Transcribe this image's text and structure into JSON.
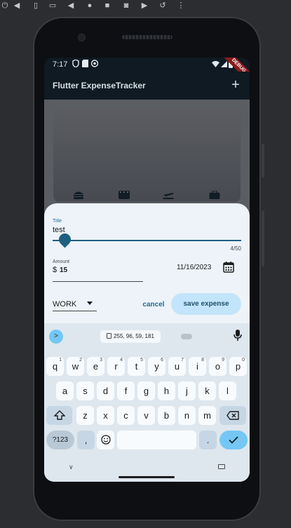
{
  "emulator_toolbar": {
    "icons": [
      "power-icon",
      "volume-up-icon",
      "volume-down-icon",
      "rotate-left-icon",
      "rotate-right-icon",
      "back-icon",
      "home-icon",
      "overview-icon",
      "camera-icon",
      "video-icon",
      "replay-icon",
      "more-icon"
    ]
  },
  "status_bar": {
    "time": "7:17",
    "debug_label": "DEBUG"
  },
  "app_bar": {
    "title": "Flutter ExpenseTracker",
    "add_icon": "+"
  },
  "chart": {
    "categories": [
      "food-icon",
      "movie-icon",
      "flight-icon",
      "work-icon"
    ]
  },
  "form": {
    "title_label": "Title",
    "title_value": "test",
    "counter": "4/50",
    "amount_label": "Amount",
    "amount_prefix": "$",
    "amount_value": "15",
    "date": "11/16/2023",
    "category": "WORK",
    "cancel_label": "cancel",
    "save_label": "save expense"
  },
  "keyboard": {
    "clipboard_text": "255, 96, 59, 181",
    "row1": [
      {
        "k": "q",
        "s": "1"
      },
      {
        "k": "w",
        "s": "2"
      },
      {
        "k": "e",
        "s": "3"
      },
      {
        "k": "r",
        "s": "4"
      },
      {
        "k": "t",
        "s": "5"
      },
      {
        "k": "y",
        "s": "6"
      },
      {
        "k": "u",
        "s": "7"
      },
      {
        "k": "i",
        "s": "8"
      },
      {
        "k": "o",
        "s": "9"
      },
      {
        "k": "p",
        "s": "0"
      }
    ],
    "row2": [
      "a",
      "s",
      "d",
      "f",
      "g",
      "h",
      "j",
      "k",
      "l"
    ],
    "row3": [
      "z",
      "x",
      "c",
      "v",
      "b",
      "n",
      "m"
    ],
    "symbols_label": "?123",
    "comma_label": ",",
    "period_label": "."
  },
  "colors": {
    "accent": "#1f5f80",
    "sheet_bg": "#edf3f8",
    "save_bg": "#c3e5fb",
    "keyboard_enter": "#74c7f4"
  }
}
